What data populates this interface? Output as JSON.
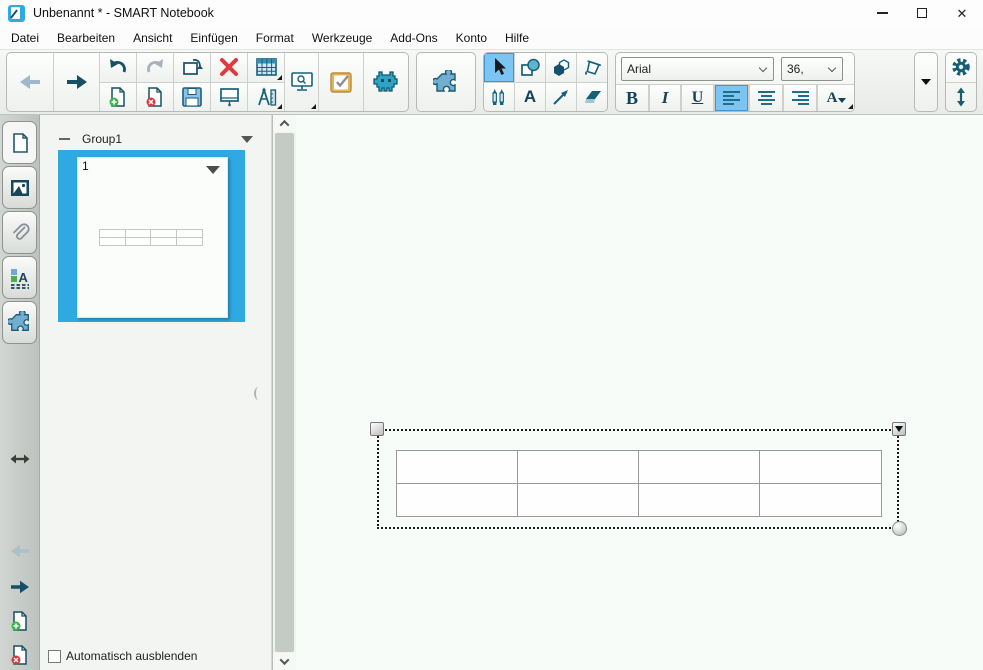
{
  "window": {
    "title": "Unbenannt * - SMART Notebook"
  },
  "menu": {
    "items": [
      "Datei",
      "Bearbeiten",
      "Ansicht",
      "Einfügen",
      "Format",
      "Werkzeuge",
      "Add-Ons",
      "Konto",
      "Hilfe"
    ]
  },
  "toolbar": {
    "font_name": "Arial",
    "font_size": "36,",
    "bold_label": "B",
    "italic_label": "I",
    "underline_label": "U",
    "text_options_label": "A"
  },
  "page_sorter": {
    "group_label": "Group1",
    "page_number": "1",
    "autohide_label": "Automatisch ausblenden"
  },
  "canvas": {
    "table_rows": 2,
    "table_cols": 4
  },
  "colors": {
    "selection_blue": "#2fa9e1",
    "icon_teal": "#175d73",
    "highlight_blue": "#7cc4f2",
    "delete_red": "#e0393f",
    "response_orange": "#e7b35d"
  }
}
